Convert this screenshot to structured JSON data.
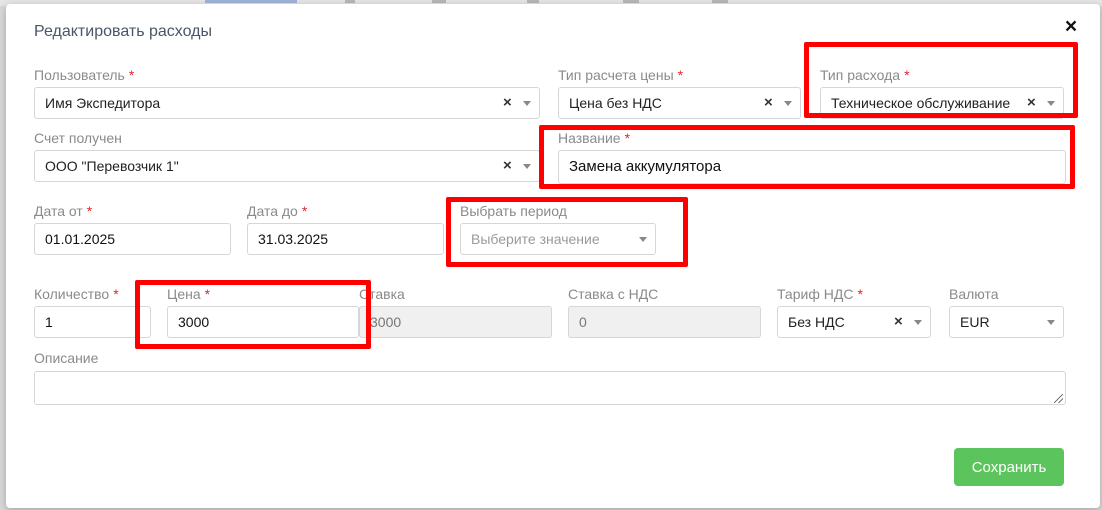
{
  "modal": {
    "title": "Редактировать расходы",
    "close_glyph": "×",
    "save_label": "Сохранить"
  },
  "required_mark": "*",
  "clear_glyph": "×",
  "fields": {
    "user": {
      "label": "Пользователь",
      "value": "Имя Экспедитора"
    },
    "price_calc_type": {
      "label": "Тип расчета цены",
      "value": "Цена без НДС"
    },
    "expense_type": {
      "label": "Тип расхода",
      "value": "Техническое обслуживание"
    },
    "invoice_received": {
      "label": "Счет получен",
      "value": "ООО \"Перевозчик 1\""
    },
    "name": {
      "label": "Название",
      "value": "Замена аккумулятора"
    },
    "date_from": {
      "label": "Дата от",
      "value": "01.01.2025"
    },
    "date_to": {
      "label": "Дата до",
      "value": "31.03.2025"
    },
    "period": {
      "label": "Выбрать период",
      "placeholder": "Выберите значение"
    },
    "quantity": {
      "label": "Количество",
      "value": "1"
    },
    "price": {
      "label": "Цена",
      "value": "3000"
    },
    "rate": {
      "label": "Ставка",
      "value": "3000"
    },
    "rate_vat": {
      "label": "Ставка с НДС",
      "value": "0"
    },
    "vat_tariff": {
      "label": "Тариф НДС",
      "value": "Без НДС"
    },
    "currency": {
      "label": "Валюта",
      "value": "EUR"
    },
    "description": {
      "label": "Описание",
      "value": ""
    }
  },
  "colors": {
    "accent_save": "#5cc45c",
    "required": "#e3262c",
    "highlight": "#ff0000"
  }
}
